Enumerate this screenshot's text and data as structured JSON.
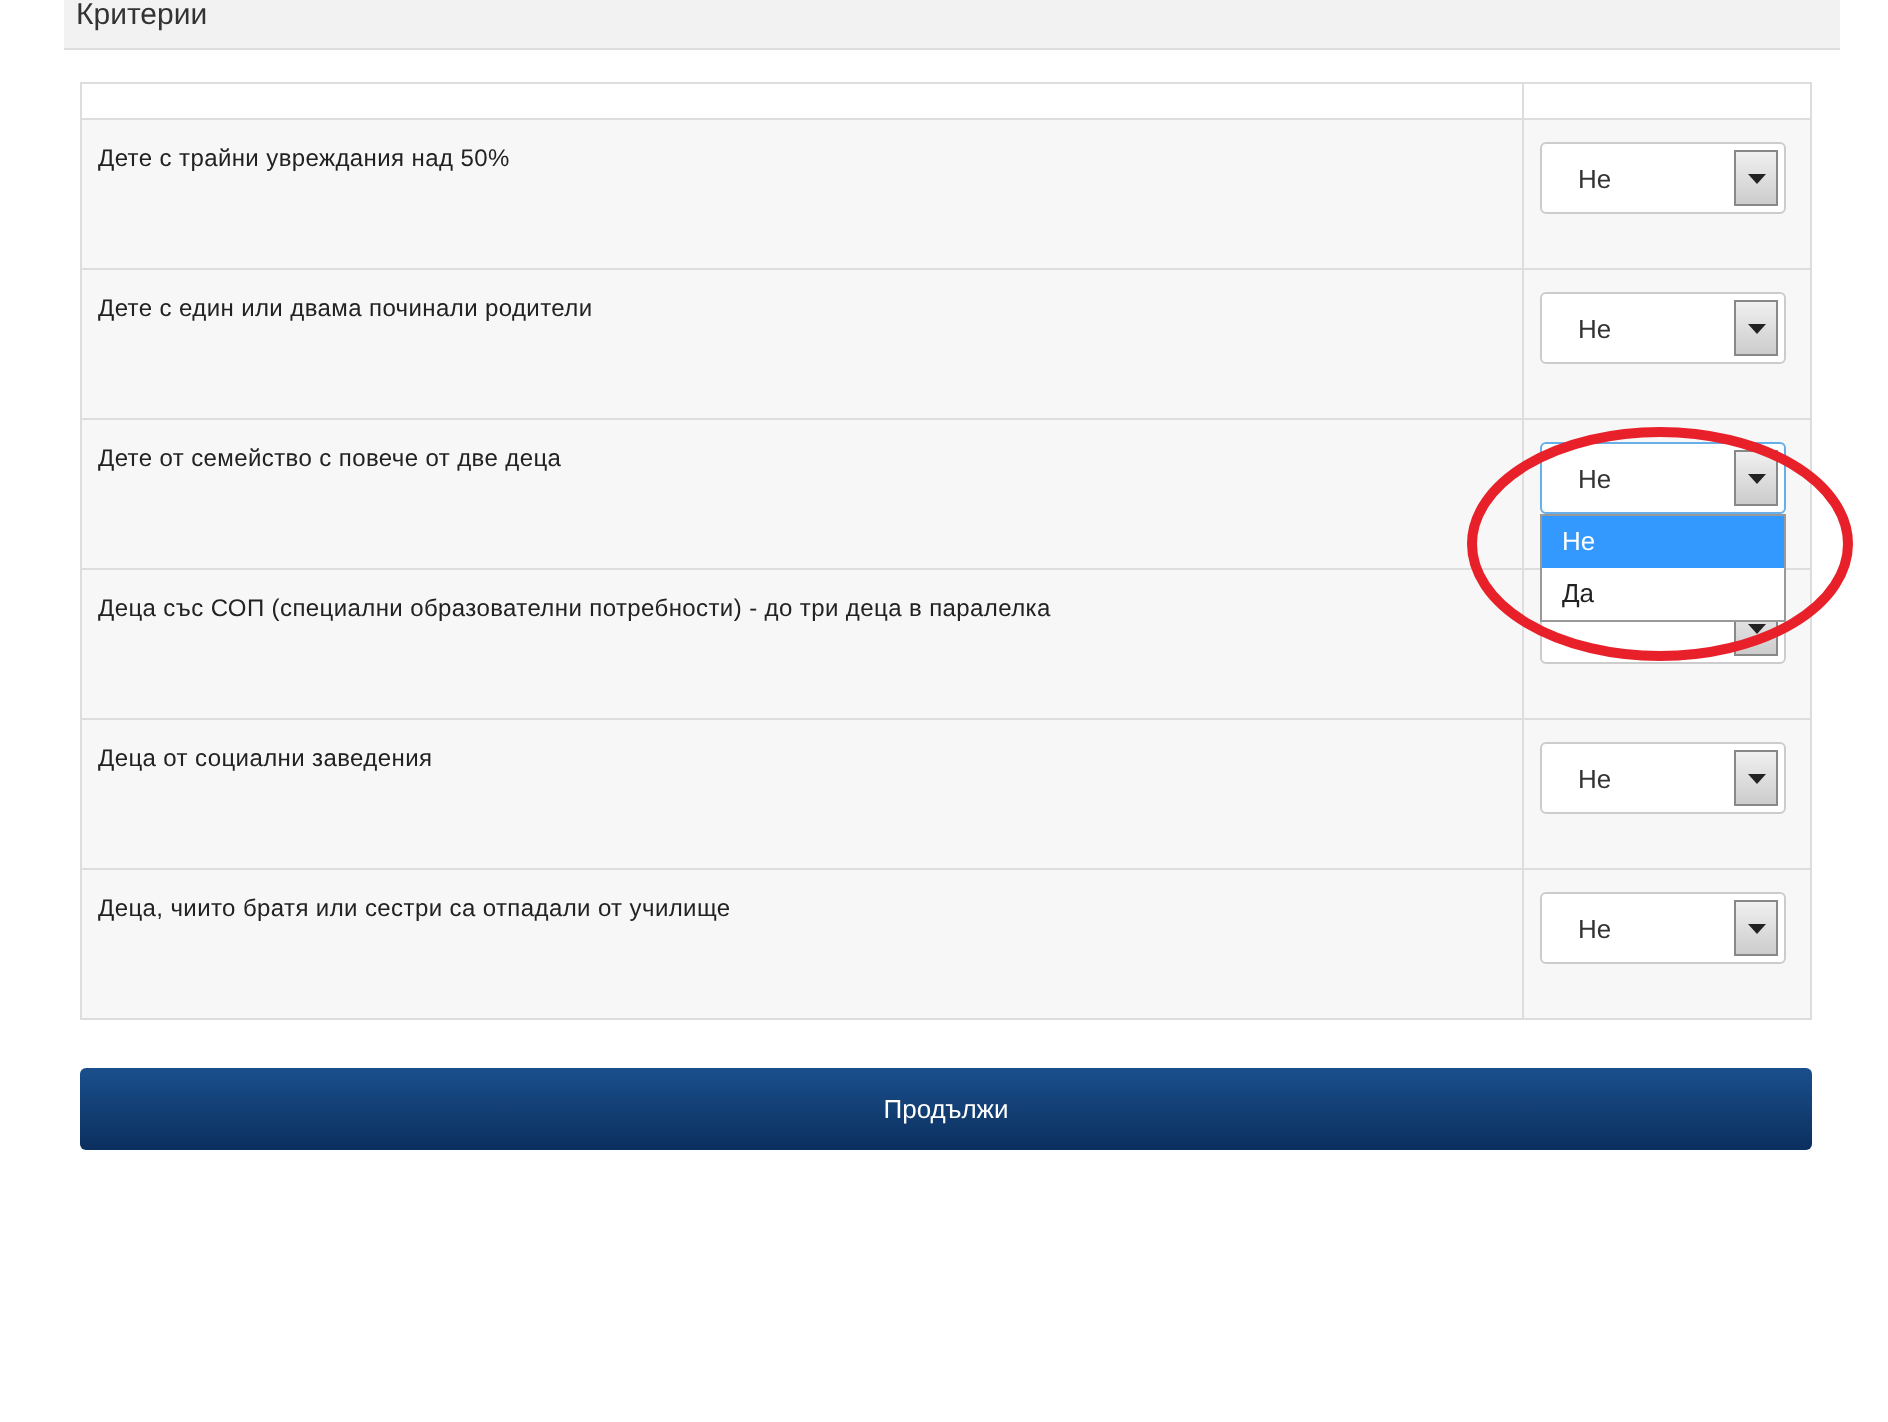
{
  "panel": {
    "title": "Критерии"
  },
  "criteria": [
    {
      "label": "Дете с трайни увреждания над 50%",
      "value": "Не",
      "open": false
    },
    {
      "label": "Дете с един или двама починали родители",
      "value": "Не",
      "open": false
    },
    {
      "label": "Дете от семейство с повече от две деца",
      "value": "Не",
      "open": true,
      "options": [
        {
          "label": "Не",
          "selected": true
        },
        {
          "label": "Да",
          "selected": false
        }
      ]
    },
    {
      "label": "Деца със СОП (специални образователни потребности) - до три деца в паралелка",
      "open": false
    },
    {
      "label": "Деца от социални заведения",
      "value": "Не",
      "open": false
    },
    {
      "label": "Деца, чиито братя или сестри са отпадали от училище",
      "value": "Не",
      "open": false
    }
  ],
  "continue_button": "Продължи",
  "highlight": {
    "kind": "ellipse"
  }
}
